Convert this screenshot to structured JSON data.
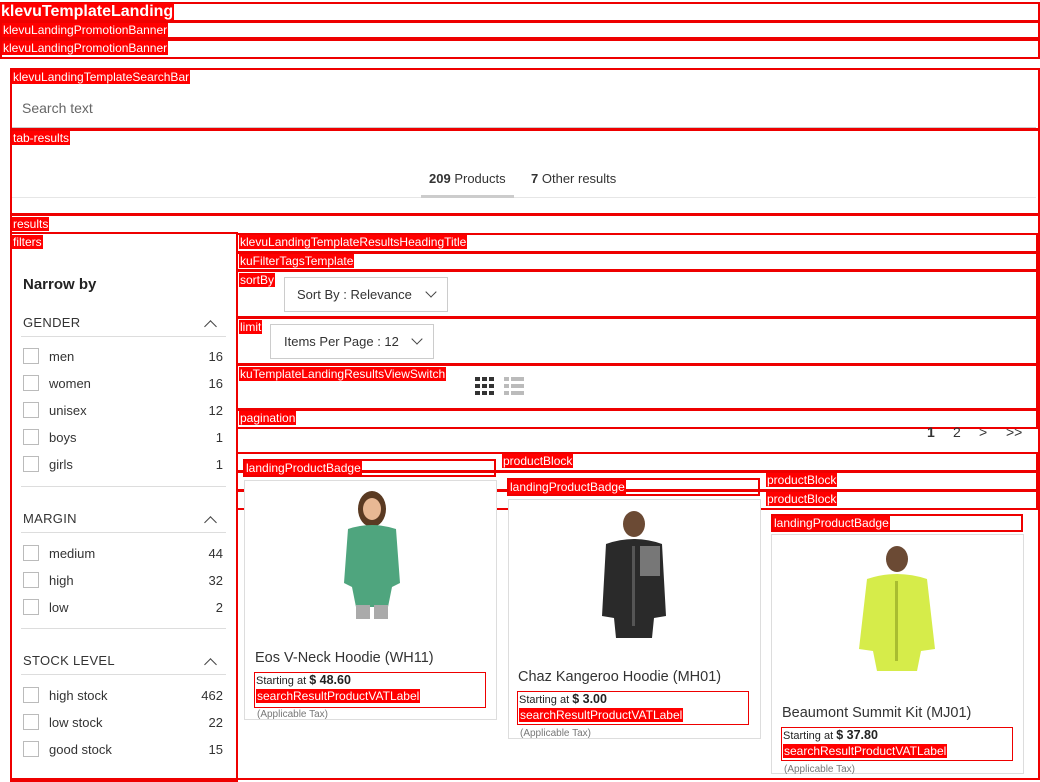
{
  "labels": {
    "template_landing": "klevuTemplateLanding",
    "promo_banner_1": "klevuLandingPromotionBanner",
    "promo_banner_2": "klevuLandingPromotionBanner",
    "search_bar": "klevuLandingTemplateSearchBar",
    "tab_results": "tab-results",
    "results": "results",
    "filters": "filters",
    "heading_title": "klevuLandingTemplateResultsHeadingTitle",
    "filter_tags": "kuFilterTagsTemplate",
    "sort_by": "sortBy",
    "limit": "limit",
    "view_switch": "kuTemplateLandingResultsViewSwitch",
    "pagination": "pagination",
    "product_badge": "landingProductBadge",
    "product_block": "productBlock",
    "vat_label": "searchResultProductVATLabel"
  },
  "search": {
    "placeholder": "Search text"
  },
  "tabs": [
    {
      "count": "209",
      "label": "Products"
    },
    {
      "count": "7",
      "label": "Other results"
    }
  ],
  "filters": {
    "heading": "Narrow by",
    "facets": [
      {
        "title": "GENDER",
        "options": [
          {
            "name": "men",
            "count": "16"
          },
          {
            "name": "women",
            "count": "16"
          },
          {
            "name": "unisex",
            "count": "12"
          },
          {
            "name": "boys",
            "count": "1"
          },
          {
            "name": "girls",
            "count": "1"
          }
        ]
      },
      {
        "title": "MARGIN",
        "options": [
          {
            "name": "medium",
            "count": "44"
          },
          {
            "name": "high",
            "count": "32"
          },
          {
            "name": "low",
            "count": "2"
          }
        ]
      },
      {
        "title": "STOCK LEVEL",
        "options": [
          {
            "name": "high stock",
            "count": "462"
          },
          {
            "name": "low stock",
            "count": "22"
          },
          {
            "name": "good stock",
            "count": "15"
          }
        ]
      }
    ]
  },
  "sort": {
    "value": "Sort By : Relevance"
  },
  "limit": {
    "value": "Items Per Page : 12"
  },
  "view_switch": {
    "grid_icon": "grid-view-icon",
    "list_icon": "list-view-icon"
  },
  "pagination": {
    "pages": [
      "1",
      "2"
    ],
    "current": "1",
    "next": ">",
    "last": ">>"
  },
  "products": [
    {
      "name": "Eos V-Neck Hoodie (WH11)",
      "price_prefix": "Starting at",
      "price": "$ 48.60",
      "tax": "(Applicable Tax)",
      "image": "woman-green-hoodie",
      "color": "#4fa57e"
    },
    {
      "name": "Chaz Kangeroo Hoodie (MH01)",
      "price_prefix": "Starting at",
      "price": "$ 3.00",
      "tax": "(Applicable Tax)",
      "image": "man-black-hoodie",
      "color": "#2a2a2a"
    },
    {
      "name": "Beaumont Summit Kit (MJ01)",
      "price_prefix": "Starting at",
      "price": "$ 37.80",
      "tax": "(Applicable Tax)",
      "image": "man-yellow-jacket",
      "color": "#d6ec4a"
    }
  ]
}
